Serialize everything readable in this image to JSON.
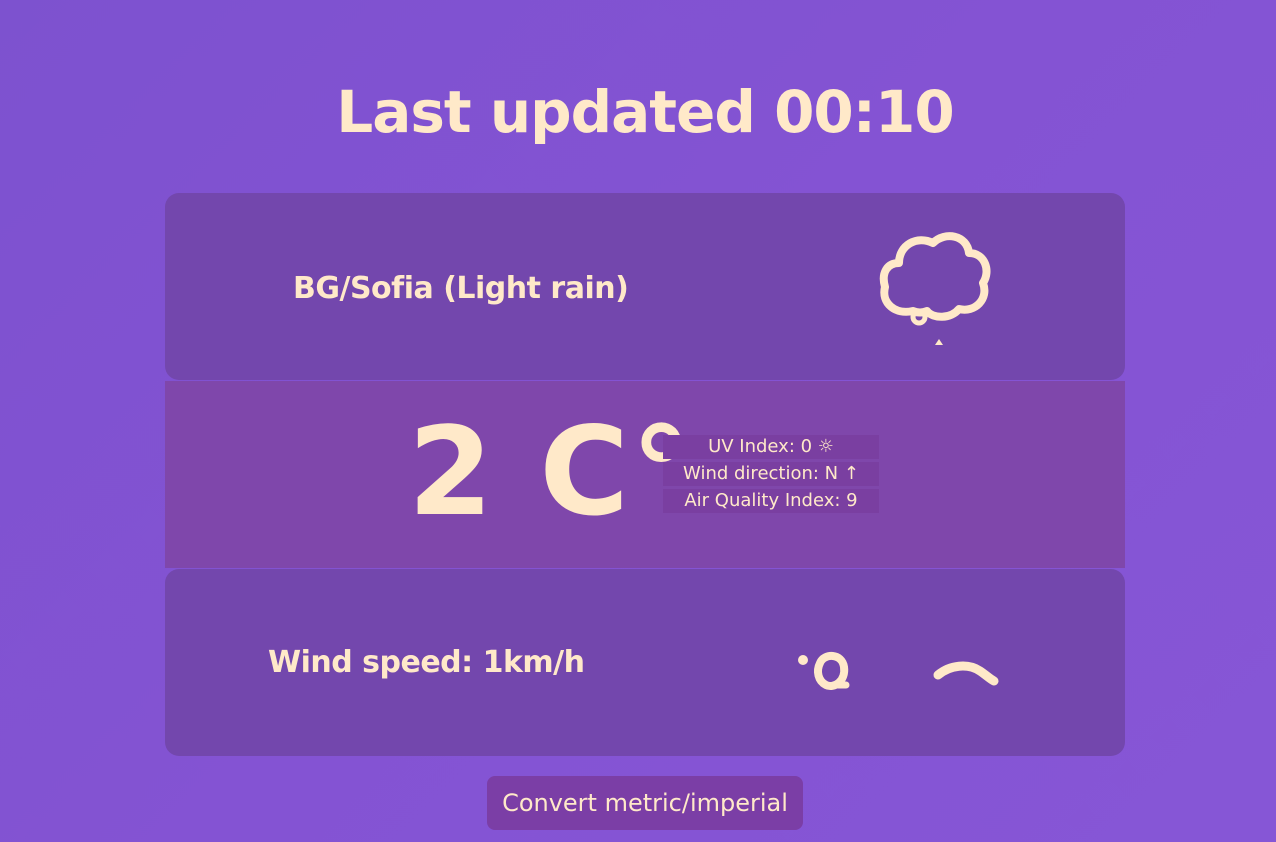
{
  "header": {
    "title": "Last updated 00:10"
  },
  "location": {
    "label": "BG/Sofia (Light rain)",
    "icon": "cloud-rain-icon"
  },
  "temperature": {
    "value": "2 C°",
    "details": [
      {
        "label": "UV Index: 0 ☼"
      },
      {
        "label": "Wind direction: N ↑"
      },
      {
        "label": "Air Quality Index: 9"
      }
    ]
  },
  "wind": {
    "label": "Wind speed: 1km/h",
    "icon": "wind-icon"
  },
  "controls": {
    "convert_label": "Convert metric/imperial"
  },
  "colors": {
    "background": "#8453d3",
    "card": "#7347ad",
    "card_highlight": "#7f47ab",
    "text": "#ffe9c9",
    "button": "#7b3ea6"
  }
}
